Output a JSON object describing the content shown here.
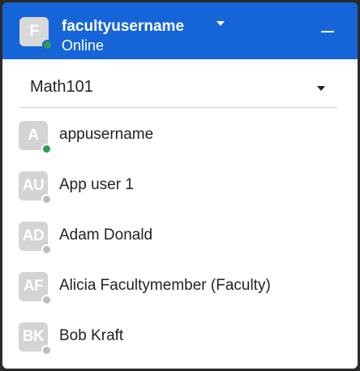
{
  "header": {
    "avatar_initial": "F",
    "username": "facultyusername",
    "status": "Online",
    "status_color": "#2e9e4f"
  },
  "course_select": {
    "value": "Math101"
  },
  "users": [
    {
      "initials": "A",
      "name": "appusername",
      "online": true
    },
    {
      "initials": "AU",
      "name": "App user 1",
      "online": false
    },
    {
      "initials": "AD",
      "name": "Adam Donald",
      "online": false
    },
    {
      "initials": "AF",
      "name": "Alicia Facultymember (Faculty)",
      "online": false
    },
    {
      "initials": "BK",
      "name": "Bob Kraft",
      "online": false
    }
  ],
  "colors": {
    "accent": "#1565d8",
    "online": "#2e9e4f",
    "offline": "#bdbdbd",
    "avatar_bg": "#d4d4d4"
  }
}
